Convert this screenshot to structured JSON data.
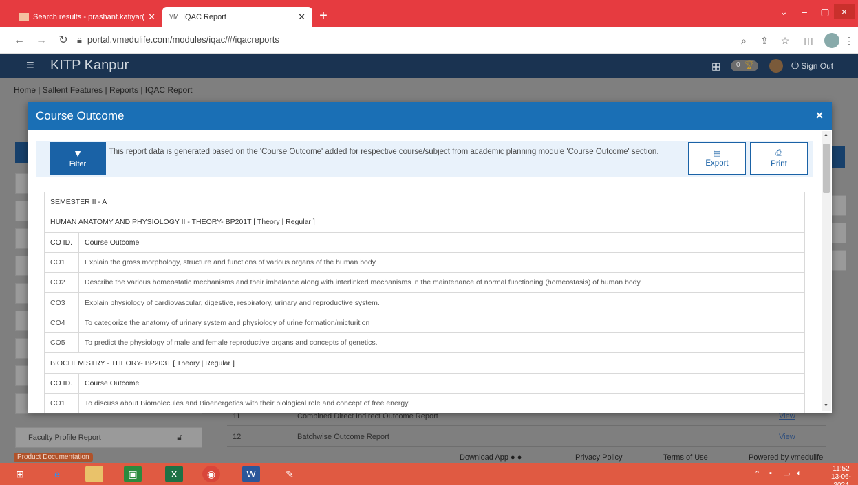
{
  "browser": {
    "tabs": [
      {
        "title": "Search results - prashant.katiyar(",
        "active": false
      },
      {
        "title": "IQAC Report",
        "active": true
      }
    ],
    "url": "portal.vmedulife.com/modules/iqac/#/iqacreports",
    "new_tab": "+",
    "window_controls": {
      "minimize": "–",
      "maximize": "▢",
      "close": "×"
    }
  },
  "app": {
    "brand": "KITP Kanpur",
    "sign_out": "Sign Out",
    "breadcrumb": "Home | Sallent Features | Reports | IQAC Report",
    "trophy_count": "0"
  },
  "background": {
    "sidebar_last": "Faculty Profile Report",
    "rows": [
      {
        "num": "11",
        "title": "Combined Direct Indirect Outcome Report",
        "view": "View"
      },
      {
        "num": "12",
        "title": "Batchwise Outcome Report",
        "view": "View"
      }
    ]
  },
  "footer": {
    "doc_badge": "Product Documentation",
    "download_app": "Download App",
    "privacy": "Privacy Policy",
    "terms": "Terms of Use",
    "powered": "Powered by vmedulife"
  },
  "taskbar": {
    "time": "11:52",
    "date": "13-06-2024"
  },
  "modal": {
    "title": "Course Outcome",
    "close": "×",
    "filter_label": "Filter",
    "info_text": "This report data is generated based on the 'Course Outcome' added for respective course/subject from academic planning module 'Course Outcome' section.",
    "export_label": "Export",
    "print_label": "Print",
    "semester": "SEMESTER II - A",
    "subjects": [
      {
        "name": "HUMAN ANATOMY AND PHYSIOLOGY II - THEORY- BP201T [ Theory | Regular ]",
        "col_id": "CO ID.",
        "col_outcome": "Course Outcome",
        "outcomes": [
          {
            "id": "CO1",
            "text": "Explain the gross morphology, structure and functions of various organs of the human body"
          },
          {
            "id": "CO2",
            "text": "Describe the various homeostatic mechanisms and their imbalance along with interlinked mechanisms in the maintenance of normal functioning (homeostasis) of human body."
          },
          {
            "id": "CO3",
            "text": "Explain physiology of cardiovascular, digestive, respiratory, urinary and reproductive system."
          },
          {
            "id": "CO4",
            "text": "To categorize the anatomy of urinary system and physiology of urine formation/micturition"
          },
          {
            "id": "CO5",
            "text": "To predict the physiology of male and female reproductive organs and concepts of genetics."
          }
        ]
      },
      {
        "name": "BIOCHEMISTRY - THEORY- BP203T [ Theory | Regular ]",
        "col_id": "CO ID.",
        "col_outcome": "Course Outcome",
        "outcomes": [
          {
            "id": "CO1",
            "text": "To discuss about Biomolecules and Bioenergetics with their biological role and concept of free energy."
          }
        ]
      }
    ]
  }
}
